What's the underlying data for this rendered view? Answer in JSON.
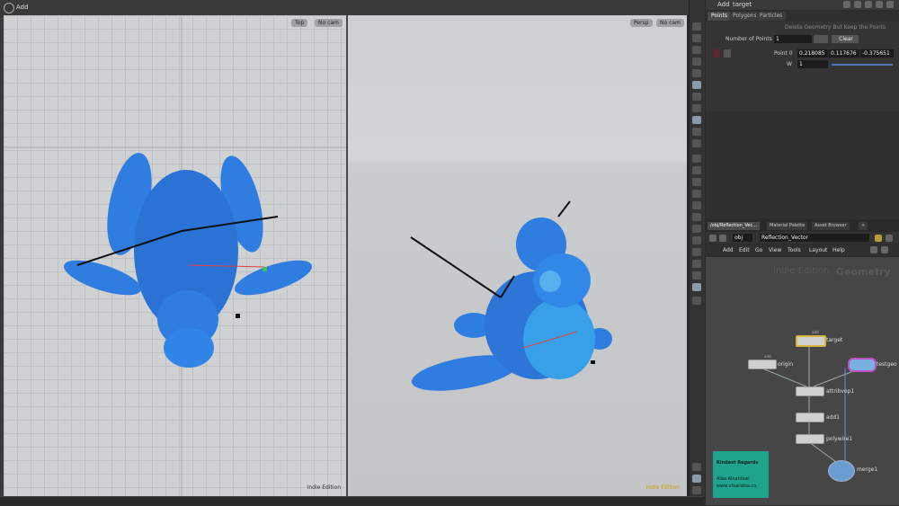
{
  "viewer": {
    "menu_label": "Add",
    "left_view": {
      "view_button": "Top",
      "cam_button": "No cam",
      "edition_label": "Indie Edition"
    },
    "right_view": {
      "view_button": "Persp",
      "cam_button": "No cam",
      "edition_label": "Indie Edition"
    }
  },
  "params": {
    "title_add": "Add",
    "title_node": "target",
    "tabs": [
      "Points",
      "Polygons",
      "Particles"
    ],
    "delete_label": "Delete Geometry But Keep the Points",
    "num_points_label": "Number of Points",
    "num_points_value": "1",
    "clear_button": "Clear",
    "point_label": "Point 0",
    "point_x": "0.218085",
    "point_y": "0.117676",
    "point_z": "-0.375651",
    "w_label": "W",
    "w_value": "1"
  },
  "network": {
    "tabs": [
      "/obj/Reflection_Vec...",
      "Material Palette",
      "Asset Browser"
    ],
    "path_obj": "obj",
    "path_node": "Reflection_Vector",
    "menu": [
      "Add",
      "Edit",
      "Go",
      "View",
      "Tools",
      "Layout",
      "Help"
    ],
    "watermark_edition": "Indie Edition",
    "watermark_context": "Geometry",
    "nodes": {
      "target": {
        "label": "target",
        "tag": "add"
      },
      "origin": {
        "label": "origin",
        "tag": "add"
      },
      "testgeometry": {
        "label": "testgeo"
      },
      "attribvop": {
        "label": "attribvop1"
      },
      "add1": {
        "label": "add1"
      },
      "polywire": {
        "label": "polywire1"
      },
      "merge": {
        "label": "merge1"
      }
    },
    "sticky_note": {
      "line1": "Kindest Regards",
      "line2": "Alaa Alnahlawi",
      "line3": "www.vfxarabia.co"
    }
  },
  "colors": {
    "model_blue": "#2f7de0",
    "note_green": "#1fa38d",
    "select_yellow": "#d8b43a"
  }
}
